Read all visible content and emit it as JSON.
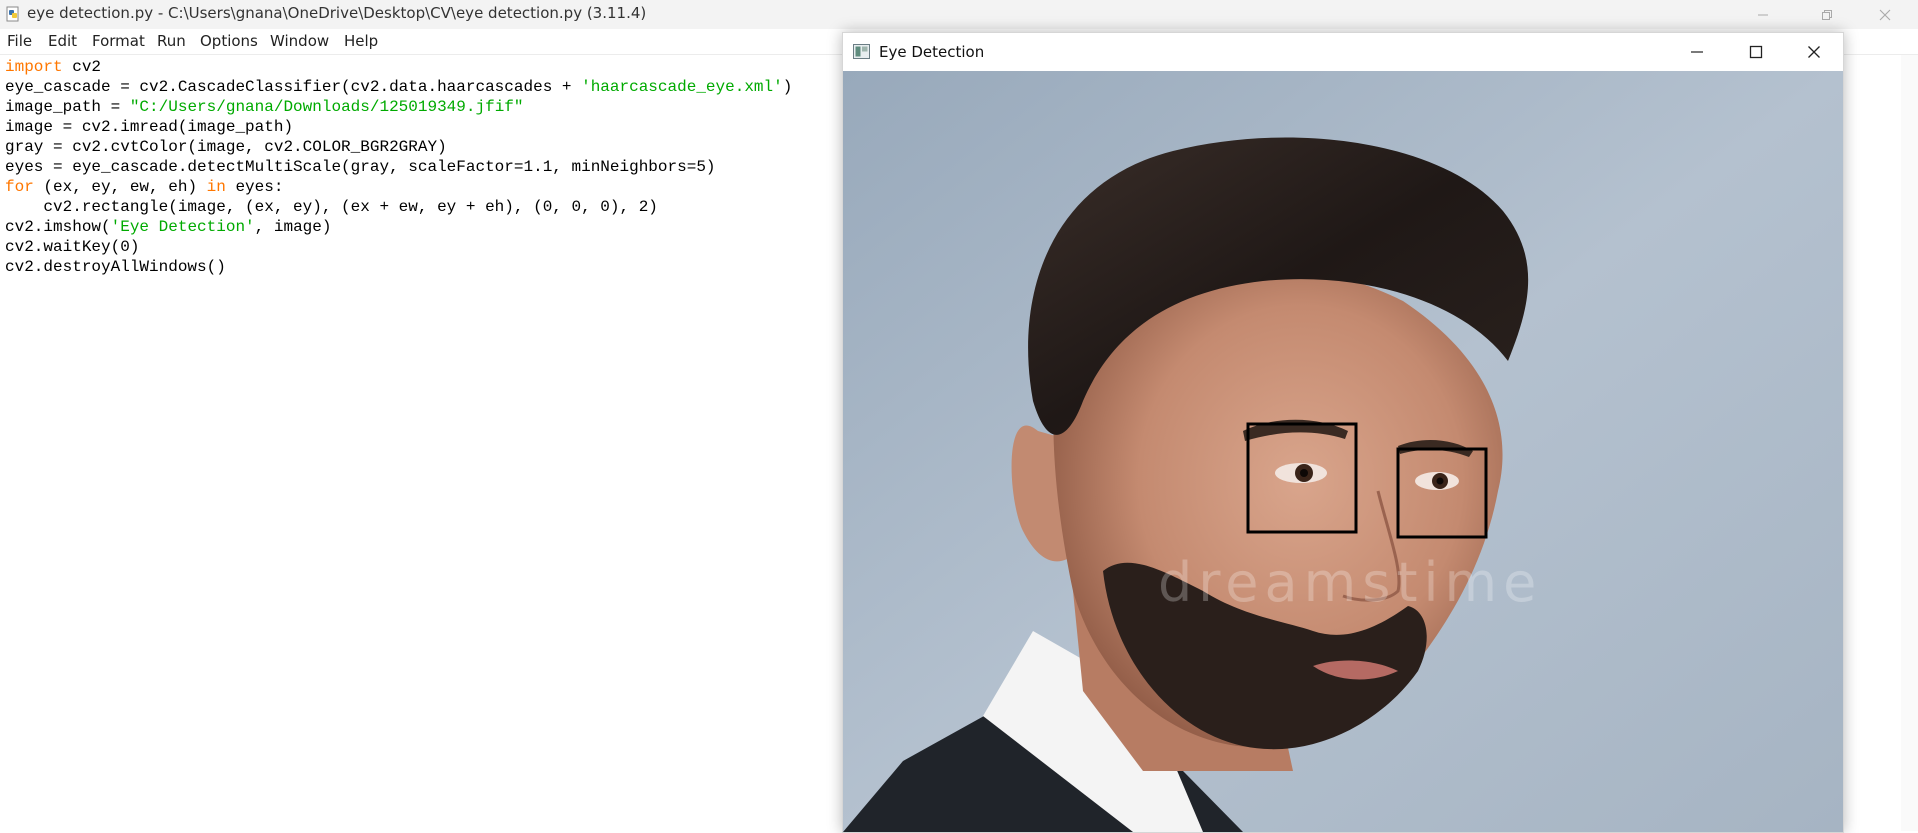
{
  "idle_window": {
    "title": "eye detection.py - C:\\Users\\gnana\\OneDrive\\Desktop\\CV\\eye detection.py (3.11.4)",
    "menu": [
      "File",
      "Edit",
      "Format",
      "Run",
      "Options",
      "Window",
      "Help"
    ],
    "code_lines": [
      [
        {
          "t": "import",
          "c": "kw"
        },
        {
          "t": " cv2"
        }
      ],
      [
        {
          "t": "eye_cascade = cv2.CascadeClassifier(cv2.data.haarcascades + "
        },
        {
          "t": "'haarcascade_eye.xml'",
          "c": "str"
        },
        {
          "t": ")"
        }
      ],
      [
        {
          "t": "image_path = "
        },
        {
          "t": "\"C:/Users/gnana/Downloads/125019349.jfif\"",
          "c": "str"
        }
      ],
      [
        {
          "t": "image = cv2.imread(image_path)"
        }
      ],
      [
        {
          "t": "gray = cv2.cvtColor(image, cv2.COLOR_BGR2GRAY)"
        }
      ],
      [
        {
          "t": "eyes = eye_cascade.detectMultiScale(gray, scaleFactor=1.1, minNeighbors=5)"
        }
      ],
      [
        {
          "t": "for",
          "c": "kw"
        },
        {
          "t": " (ex, ey, ew, eh) "
        },
        {
          "t": "in",
          "c": "kw"
        },
        {
          "t": " eyes:"
        }
      ],
      [
        {
          "t": "    cv2.rectangle(image, (ex, ey), (ex + ew, ey + eh), (0, 0, 0), 2)"
        }
      ],
      [
        {
          "t": "cv2.imshow("
        },
        {
          "t": "'Eye Detection'",
          "c": "str"
        },
        {
          "t": ", image)"
        }
      ],
      [
        {
          "t": "cv2.waitKey(0)"
        }
      ],
      [
        {
          "t": "cv2.destroyAllWindows()"
        }
      ]
    ]
  },
  "cv_window": {
    "title": "Eye Detection",
    "watermark": "dreamstime"
  },
  "colors": {
    "keyword": "#ff7700",
    "string": "#00aa00",
    "background_photo": "#a9b8c8",
    "detection_box": "#000000"
  },
  "icons": [
    "python-file-icon",
    "minimize-icon",
    "maximize-icon",
    "close-icon",
    "opencv-window-icon"
  ]
}
